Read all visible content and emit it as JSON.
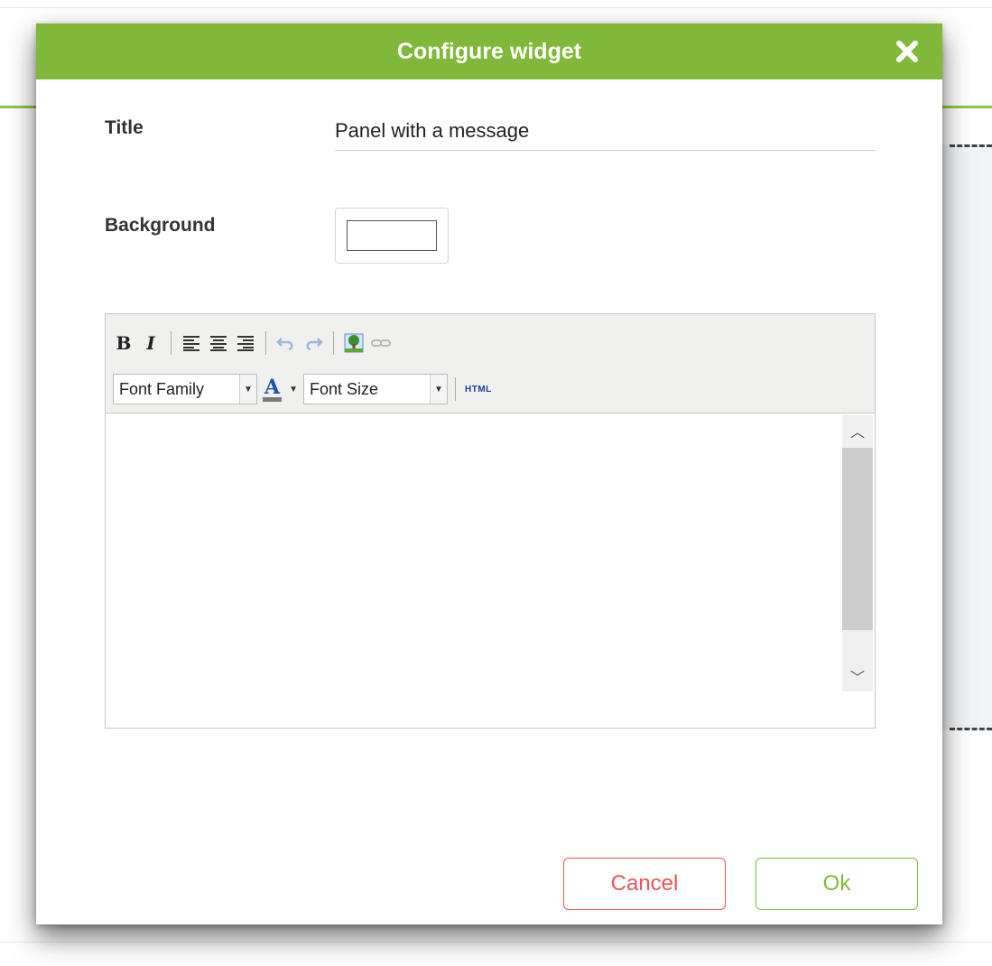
{
  "dialog": {
    "title": "Configure widget",
    "close_icon": "close-icon",
    "accent_color": "#80b93a"
  },
  "fields": {
    "title_label": "Title",
    "title_value": "Panel with a message",
    "background_label": "Background",
    "background_color": "#ffffff"
  },
  "editor": {
    "toolbar_row1": [
      {
        "name": "bold-button",
        "label": "B"
      },
      {
        "name": "italic-button",
        "label": "I"
      },
      {
        "name": "align-left-icon"
      },
      {
        "name": "align-center-icon"
      },
      {
        "name": "align-right-icon"
      },
      {
        "name": "undo-icon"
      },
      {
        "name": "redo-icon"
      },
      {
        "name": "insert-image-icon"
      },
      {
        "name": "link-icon"
      }
    ],
    "font_family": "Font Family",
    "font_color_glyph": "A",
    "font_size": "Font Size",
    "html_button": "HTML",
    "content": ""
  },
  "footer": {
    "cancel_label": "Cancel",
    "ok_label": "Ok",
    "cancel_color": "#e8545a",
    "ok_color": "#80b93a"
  }
}
